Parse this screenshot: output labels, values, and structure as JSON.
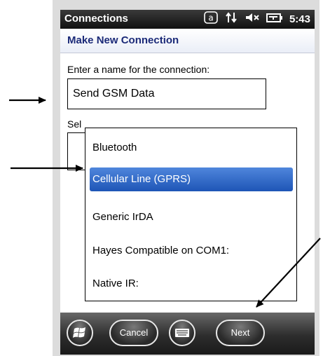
{
  "titlebar": {
    "title": "Connections",
    "time": "5:43",
    "icons": [
      "keypad-a-icon",
      "network-arrows-icon",
      "speaker-muted-icon",
      "battery-charging-icon"
    ]
  },
  "header": {
    "title": "Make New Connection"
  },
  "form": {
    "name_prompt": "Enter a name for the connection:",
    "name_value": "Send GSM Data",
    "select_label": "Sel"
  },
  "dropdown": {
    "options": [
      "Bluetooth",
      "Cellular Line (GPRS)",
      "Generic IrDA",
      "Hayes Compatible on COM1:",
      "Native IR:"
    ],
    "selected": "Cellular Line (GPRS)"
  },
  "softkeys": {
    "cancel": "Cancel",
    "next": "Next"
  },
  "colors": {
    "title_bar": "#1a1a1a",
    "header_text": "#1b2a78",
    "selection": "#2a62c5"
  }
}
